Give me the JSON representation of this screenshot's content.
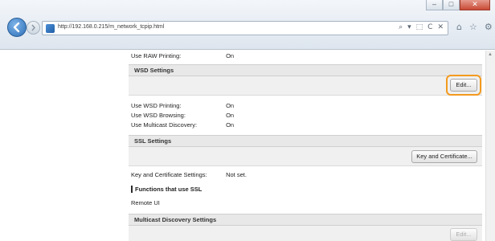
{
  "browser": {
    "url": "http://192.168.0.215/m_network_tcpip.html",
    "win_minimize": "–",
    "win_maximize": "□",
    "win_close": "✕",
    "addr_tools": [
      "⌕",
      "▾",
      "⬚",
      "C",
      "✕"
    ],
    "toolbar_icons": [
      "⌂",
      "☆",
      "⚙"
    ]
  },
  "raw": {
    "label": "Use RAW Printing:",
    "value": "On"
  },
  "wsd": {
    "title": "WSD Settings",
    "edit_label": "Edit...",
    "rows": [
      {
        "label": "Use WSD Printing:",
        "value": "On"
      },
      {
        "label": "Use WSD Browsing:",
        "value": "On"
      },
      {
        "label": "Use Multicast Discovery:",
        "value": "On"
      }
    ]
  },
  "ssl": {
    "title": "SSL Settings",
    "button_label": "Key and Certificate...",
    "row": {
      "label": "Key and Certificate Settings:",
      "value": "Not set."
    },
    "functions_heading": "Functions that use SSL",
    "function_item": "Remote UI"
  },
  "multicast": {
    "title": "Multicast Discovery Settings",
    "edit_label": "Edit..."
  }
}
